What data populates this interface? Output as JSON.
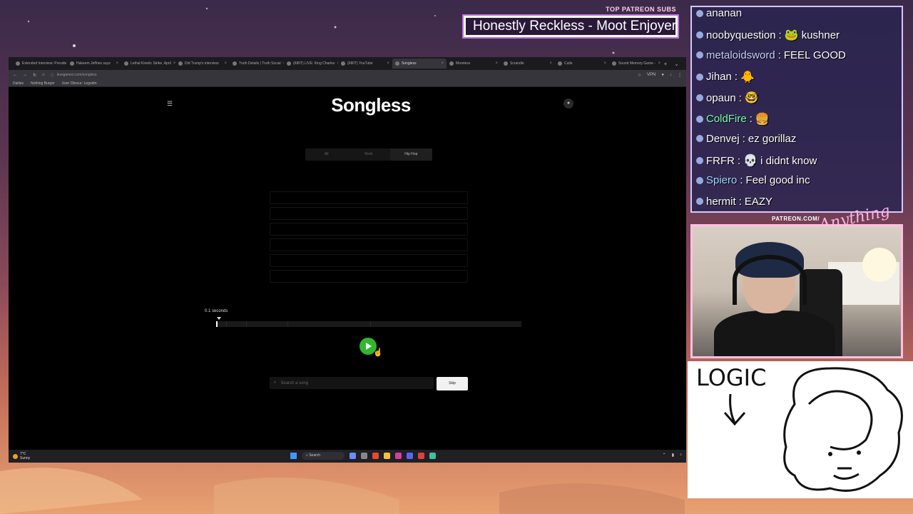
{
  "overlay": {
    "patreon_label": "TOP PATREON SUBS",
    "patreon_name": "Honestly Reckless - Moot Enjoyer",
    "webcam_label": "PATREON.COM/",
    "webcam_script": "Anything Else"
  },
  "browser": {
    "tabs": [
      {
        "label": "Extended Interview: Preside"
      },
      {
        "label": "Hakeem Jeffries says"
      },
      {
        "label": "Lethal Kinetic Strike, April"
      },
      {
        "label": "Did Trump's interview"
      },
      {
        "label": "Truth Details | Truth Social"
      },
      {
        "label": "(680T) LIVE: King Charles"
      },
      {
        "label": "(680T) YouTube"
      },
      {
        "label": "Songless",
        "active": true
      },
      {
        "label": "Moreless"
      },
      {
        "label": "Scrandle"
      },
      {
        "label": "Cutle"
      },
      {
        "label": "Sound Memory Game -"
      }
    ],
    "url": "lessgames.com/songless",
    "vpn_label": "VPN",
    "bookmarks": [
      "Dailies",
      "Nothing Burger",
      "User Obscur: Legodm"
    ]
  },
  "songless": {
    "logo": "Songless",
    "genre_tabs": [
      {
        "label": "All",
        "active": false
      },
      {
        "label": "Rock",
        "active": false
      },
      {
        "label": "Hip Hop",
        "active": true
      }
    ],
    "guess_rows": 6,
    "seconds_label": "0.1 seconds",
    "progress_fraction": 0.004,
    "search_placeholder": "Search a song",
    "skip_label": "Skip"
  },
  "taskbar": {
    "temp": "7°C",
    "weather": "Sunny",
    "search_label": "Search"
  },
  "chat": [
    {
      "user": "ananan",
      "text": "",
      "color": "#ffffff",
      "emote": ""
    },
    {
      "user": "noobyquestion",
      "text": "kushner",
      "color": "#ffffff",
      "emote": "🐸"
    },
    {
      "user": "metaloidsword",
      "text": "FEEL GOOD",
      "color": "#c8d0ff",
      "emote": ""
    },
    {
      "user": "Jihan",
      "text": "",
      "color": "#ffffff",
      "emote": "🐥"
    },
    {
      "user": "opaun",
      "text": "",
      "color": "#ffffff",
      "emote": "🤓"
    },
    {
      "user": "ColdFire",
      "text": "",
      "color": "#7dffb0",
      "emote": "🍔"
    },
    {
      "user": "Denvej",
      "text": "ez gorillaz",
      "color": "#ffffff",
      "emote": ""
    },
    {
      "user": "FRFR",
      "text": "i didnt know",
      "color": "#ffffff",
      "emote": "💀"
    },
    {
      "user": "Spiero",
      "text": "Feel good inc",
      "color": "#a0d8ff",
      "emote": ""
    },
    {
      "user": "hermit",
      "text": "EAZY",
      "color": "#ffffff",
      "emote": ""
    }
  ],
  "drawing": {
    "text": "LOGIC"
  }
}
